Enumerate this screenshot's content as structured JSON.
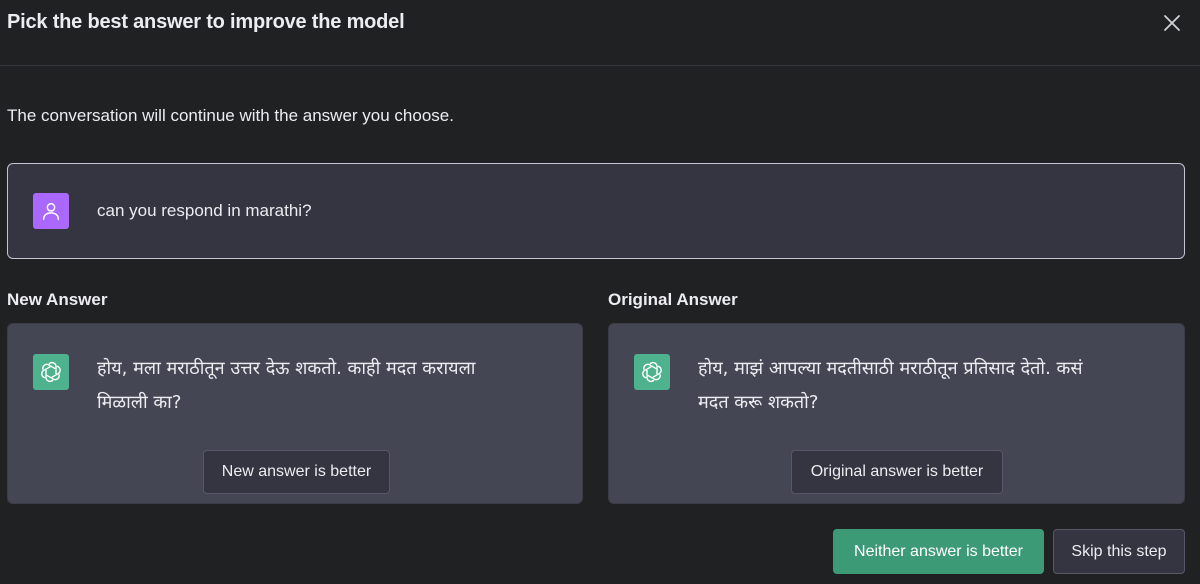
{
  "dialog": {
    "title": "Pick the best answer to improve the model",
    "close_icon": "close-icon",
    "subtitle": "The conversation will continue with the answer you choose."
  },
  "prompt": {
    "avatar_icon": "user-icon",
    "avatar_color": "#ab68ff",
    "text": "can you respond in marathi?"
  },
  "answers": [
    {
      "label": "New Answer",
      "avatar_icon": "openai-logo-icon",
      "text": "होय, मला मराठीतून उत्तर देऊ शकतो. काही मदत करायला मिळाली का?",
      "button_label": "New answer is better"
    },
    {
      "label": "Original Answer",
      "avatar_icon": "openai-logo-icon",
      "text": "होय, माझं आपल्या मदतीसाठी मराठीतून प्रतिसाद देतो. कसं मदत करू शकतो?",
      "button_label": "Original answer is better"
    }
  ],
  "footer": {
    "neither_label": "Neither answer is better",
    "skip_label": "Skip this step"
  },
  "colors": {
    "background": "#202123",
    "card": "#444654",
    "accent_green": "#3d9a77"
  }
}
